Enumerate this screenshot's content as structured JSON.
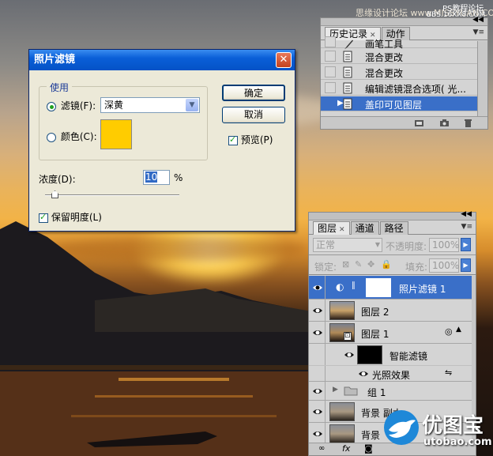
{
  "watermarks": {
    "top_right": "思缘设计论坛 www.MISSYUAN.COM",
    "ps_site": "PS教程论坛",
    "ps_site_url": "BBS.16XX8.COM"
  },
  "dialog": {
    "title": "照片滤镜",
    "close_icon": "close-icon",
    "use_group": "使用",
    "filter_label": "滤镜(F):",
    "filter_value": "深黄",
    "color_label": "颜色(C):",
    "color_swatch": "#ffcc00",
    "ok": "确定",
    "cancel": "取消",
    "preview": "预览(P)",
    "density_label": "浓度(D):",
    "density_value": "10",
    "density_unit": "%",
    "density_fraction": 0.1,
    "preserve_luminosity": "保留明度(L)"
  },
  "history": {
    "tabs": [
      "历史记录",
      "动作"
    ],
    "items": [
      "画笔工具",
      "混合更改",
      "混合更改",
      "编辑滤镜混合选项( 光...",
      "盖印可见图层"
    ],
    "selected_index": 4
  },
  "layers": {
    "tabs": [
      "图层",
      "通道",
      "路径"
    ],
    "blend_mode": "正常",
    "opacity_label": "不透明度:",
    "opacity_value": "100%",
    "lock_label": "锁定:",
    "fill_label": "填充:",
    "fill_value": "100%",
    "rows": {
      "photo_filter": "照片滤镜 1",
      "layer2": "图层 2",
      "layer1": "图层 1",
      "smart_filters": "智能滤镜",
      "lighting": "光照效果",
      "group1": "组 1",
      "bg_copy": "背景 副本",
      "bg": "背景"
    }
  },
  "logo": {
    "name": "优图宝",
    "url": "utobao.com"
  },
  "colors": {
    "accent": "#3a6fc8",
    "title_bar": "#0a5fd8",
    "sky": "#eab35a"
  }
}
